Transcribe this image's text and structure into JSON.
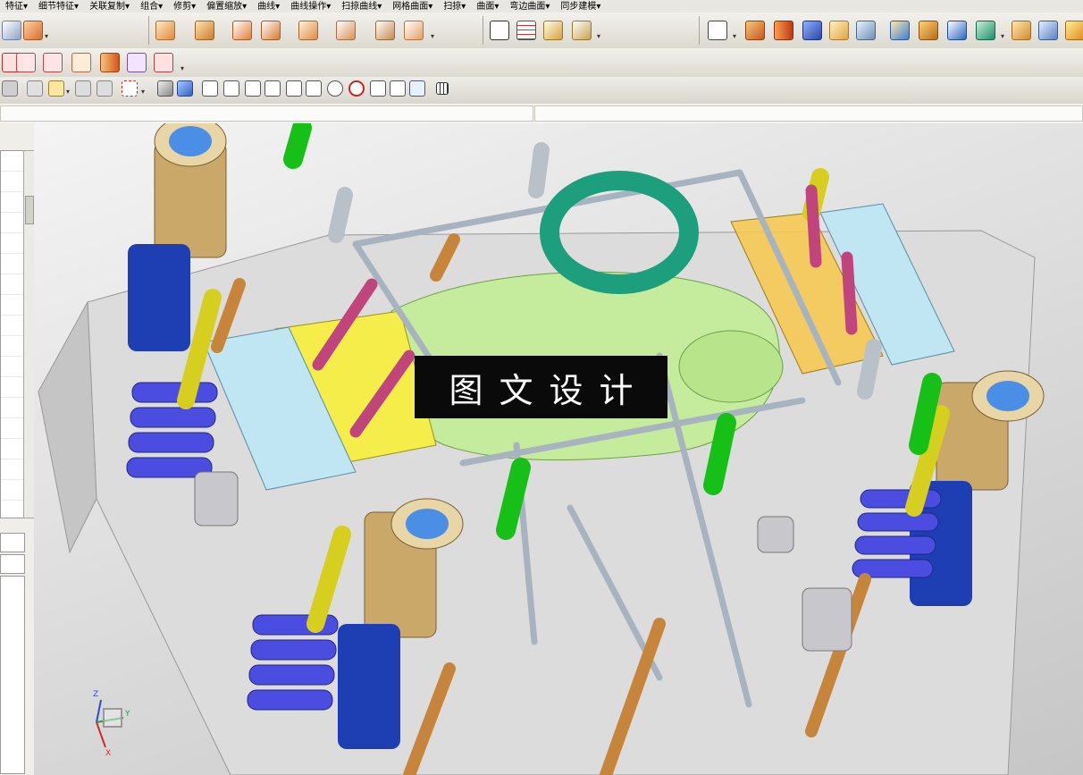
{
  "menu": {
    "items": [
      "特征▾",
      "细节特征▾",
      "关联复制▾",
      "组合▾",
      "修剪▾",
      "偏置缩放▾",
      "曲线▾",
      "曲线操作▾",
      "扫掠曲线▾",
      "网格曲面▾",
      "扫掠▾",
      "曲面▾",
      "弯边曲面▾",
      "同步建模▾"
    ]
  },
  "watermark": {
    "text": "图文设计"
  },
  "triad": {
    "z": "Z",
    "y": "Y",
    "x": "X"
  },
  "colors": {
    "toolbar_top": "#f2f1ec",
    "viewport_bg": "#dadada",
    "plate": "#dcdcdc",
    "mold_green": "#c5ec9c",
    "insert_yellow": "#f5ee4a",
    "block_cyan": "#bfe6f2",
    "pillar_blue": "#1e3fb3",
    "pillar_tan": "#c9a86a",
    "spring_blue": "#4a4de0",
    "ring_teal": "#1d9e7c",
    "rod_orange": "#c7853c",
    "bolt_green": "#17c017",
    "pin_pink": "#c1457d",
    "gray_rod": "#a7b4c0"
  },
  "icons": {
    "toolbar1": [
      "unite-icon",
      "subtract-icon",
      "trim-body-icon",
      "offset-face-icon",
      "split-body-icon",
      "extract-icon",
      "mirror-icon",
      "pattern-icon",
      "point-icon",
      "table-icon",
      "dimension-icon",
      "measure-icon",
      "sketch-icon",
      "box-icon",
      "cylinder-icon",
      "cube-icon",
      "face-icon",
      "blend-icon",
      "move-face-icon",
      "chamfer-icon",
      "hole-icon",
      "shell-icon",
      "draft-icon"
    ],
    "toolbar2": [
      "align-icon",
      "center-icon",
      "distribute-icon",
      "slot-icon",
      "rib-icon",
      "pocket-icon"
    ],
    "toolbar3": [
      "filter-icon",
      "snap-icon",
      "selection-icon",
      "view-triad-icon",
      "shaded-icon",
      "end-point-icon",
      "mid-point-icon",
      "control-point-icon",
      "intersection-icon",
      "tangent-icon",
      "arc-center-icon",
      "quadrant-icon",
      "point-on-curve-icon",
      "grid-icon"
    ]
  }
}
